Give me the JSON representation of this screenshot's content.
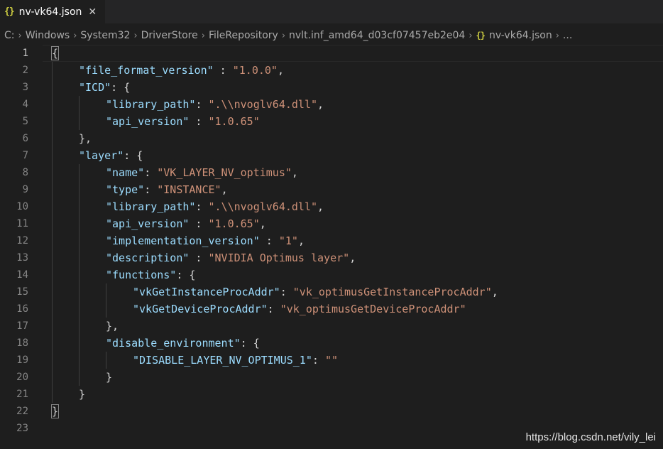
{
  "tab": {
    "icon": "json-braces-icon",
    "icon_text": "{}",
    "label": "nv-vk64.json",
    "close_glyph": "✕"
  },
  "breadcrumb": {
    "items": [
      "C:",
      "Windows",
      "System32",
      "DriverStore",
      "FileRepository",
      "nvlt.inf_amd64_d03cf07457eb2e04",
      "nv-vk64.json",
      "..."
    ],
    "file_icon_text": "{}",
    "separator": "›"
  },
  "editor": {
    "active_line": 1,
    "lines": [
      {
        "n": "1"
      },
      {
        "n": "2"
      },
      {
        "n": "3"
      },
      {
        "n": "4"
      },
      {
        "n": "5"
      },
      {
        "n": "6"
      },
      {
        "n": "7"
      },
      {
        "n": "8"
      },
      {
        "n": "9"
      },
      {
        "n": "10"
      },
      {
        "n": "11"
      },
      {
        "n": "12"
      },
      {
        "n": "13"
      },
      {
        "n": "14"
      },
      {
        "n": "15"
      },
      {
        "n": "16"
      },
      {
        "n": "17"
      },
      {
        "n": "18"
      },
      {
        "n": "19"
      },
      {
        "n": "20"
      },
      {
        "n": "21"
      },
      {
        "n": "22"
      },
      {
        "n": "23"
      }
    ],
    "tokens": {
      "l1": [
        "{"
      ],
      "l2": [
        "\"file_format_version\"",
        " : ",
        "\"1.0.0\"",
        ","
      ],
      "l3": [
        "\"ICD\"",
        ": {"
      ],
      "l4": [
        "\"library_path\"",
        ": ",
        "\".\\\\nvoglv64.dll\"",
        ","
      ],
      "l5": [
        "\"api_version\"",
        " : ",
        "\"1.0.65\""
      ],
      "l6": [
        "},"
      ],
      "l7": [
        "\"layer\"",
        ": {"
      ],
      "l8": [
        "\"name\"",
        ": ",
        "\"VK_LAYER_NV_optimus\"",
        ","
      ],
      "l9": [
        "\"type\"",
        ": ",
        "\"INSTANCE\"",
        ","
      ],
      "l10": [
        "\"library_path\"",
        ": ",
        "\".\\\\nvoglv64.dll\"",
        ","
      ],
      "l11": [
        "\"api_version\"",
        " : ",
        "\"1.0.65\"",
        ","
      ],
      "l12": [
        "\"implementation_version\"",
        " : ",
        "\"1\"",
        ","
      ],
      "l13": [
        "\"description\"",
        " : ",
        "\"NVIDIA Optimus layer\"",
        ","
      ],
      "l14": [
        "\"functions\"",
        ": {"
      ],
      "l15": [
        "\"vkGetInstanceProcAddr\"",
        ": ",
        "\"vk_optimusGetInstanceProcAddr\"",
        ","
      ],
      "l16": [
        "\"vkGetDeviceProcAddr\"",
        ": ",
        "\"vk_optimusGetDeviceProcAddr\""
      ],
      "l17": [
        "},"
      ],
      "l18": [
        "\"disable_environment\"",
        ": {"
      ],
      "l19": [
        "\"DISABLE_LAYER_NV_OPTIMUS_1\"",
        ": ",
        "\"\""
      ],
      "l20": [
        "}"
      ],
      "l21": [
        "}"
      ],
      "l22": [
        "}"
      ]
    }
  },
  "watermark": "https://blog.csdn.net/vily_lei",
  "colors": {
    "key": "#9cdcfe",
    "string": "#ce9178",
    "punct": "#d4d4d4",
    "icon_yellow": "#cbcb41"
  }
}
